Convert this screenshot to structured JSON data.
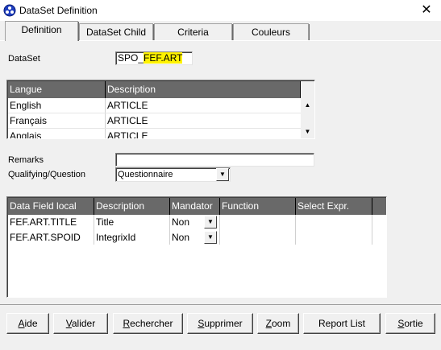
{
  "window": {
    "title": "DataSet Definition",
    "close": "✕"
  },
  "tabs": [
    {
      "label": "Definition"
    },
    {
      "label": "DataSet Child"
    },
    {
      "label": "Criteria"
    },
    {
      "label": "Couleurs"
    }
  ],
  "dataset": {
    "label": "DataSet",
    "prefix": "SPO_",
    "highlighted": "FEF.ART"
  },
  "lang_grid": {
    "headers": [
      "Langue",
      "Description"
    ],
    "rows": [
      {
        "langue": "English",
        "description": "ARTICLE"
      },
      {
        "langue": "Français",
        "description": "ARTICLE"
      },
      {
        "langue": "Anglais",
        "description": "ARTICLE"
      }
    ]
  },
  "remarks": {
    "label": "Remarks",
    "value": ""
  },
  "qualifying": {
    "label": "Qualifying/Question",
    "value": "Questionnaire"
  },
  "fields_grid": {
    "headers": [
      "Data Field local",
      "Description",
      "Mandator",
      "Function",
      "Select Expr."
    ],
    "rows": [
      {
        "field": "FEF.ART.TITLE",
        "description": "Title",
        "mandatory": "Non",
        "function": "",
        "select": ""
      },
      {
        "field": "FEF.ART.SPOID",
        "description": "IntegrixId",
        "mandatory": "Non",
        "function": "",
        "select": ""
      }
    ]
  },
  "buttons": [
    {
      "mnemonic": "A",
      "rest": "ide"
    },
    {
      "mnemonic": "V",
      "rest": "alider"
    },
    {
      "mnemonic": "R",
      "rest": "echercher"
    },
    {
      "mnemonic": "S",
      "rest": "upprimer"
    },
    {
      "mnemonic": "Z",
      "rest": "oom"
    },
    {
      "mnemonic": "",
      "rest": "Report List",
      "underline_char": "L"
    },
    {
      "mnemonic": "S",
      "rest": "ortie"
    }
  ],
  "colors": {
    "header_bg": "#696969",
    "highlight": "#fff200",
    "window_bg": "#f0f0f0"
  }
}
